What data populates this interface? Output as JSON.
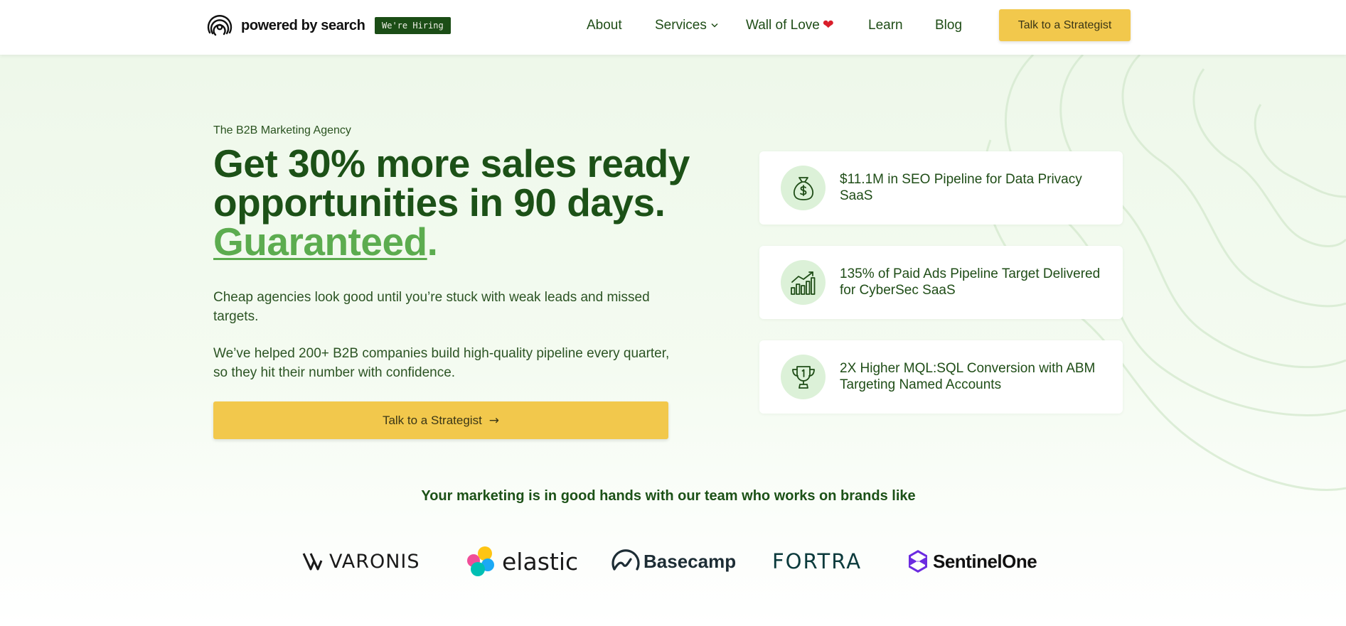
{
  "header": {
    "logo_text": "powered by search",
    "hiring_badge": "We're Hiring",
    "nav": {
      "about": "About",
      "services": "Services",
      "wall_of_love": "Wall of Love",
      "learn": "Learn",
      "blog": "Blog"
    },
    "cta": "Talk to a Strategist"
  },
  "hero": {
    "eyebrow": "The B2B Marketing Agency",
    "headline_part1": "Get 30% more sales ready opportunities in 90 days. ",
    "headline_accent": "Guaranteed",
    "headline_end": ".",
    "paragraph1": "Cheap agencies look good until you’re stuck with weak leads and missed targets.",
    "paragraph2": "We’ve helped 200+ B2B companies build high-quality pipeline every quarter, so they hit their number with confidence.",
    "cta": "Talk to a Strategist",
    "cta_arrow": "→"
  },
  "results": [
    {
      "icon": "money-bag-icon",
      "text": "$11.1M in SEO Pipeline for Data Privacy SaaS"
    },
    {
      "icon": "growth-chart-icon",
      "text": "135% of Paid Ads Pipeline Target Delivered for CyberSec SaaS"
    },
    {
      "icon": "trophy-icon",
      "text": "2X Higher MQL:SQL Conversion with ABM Targeting Named Accounts"
    }
  ],
  "brands": {
    "title": "Your marketing is in good hands with our team who works on brands like",
    "logos": [
      "VARONIS",
      "elastic",
      "Basecamp",
      "FORTRA",
      "SentinelOne"
    ]
  },
  "colors": {
    "brand_green": "#1c5117",
    "accent_green": "#5cac4f",
    "cta_yellow": "#f2c84c",
    "heart_red": "#d91e2a"
  }
}
